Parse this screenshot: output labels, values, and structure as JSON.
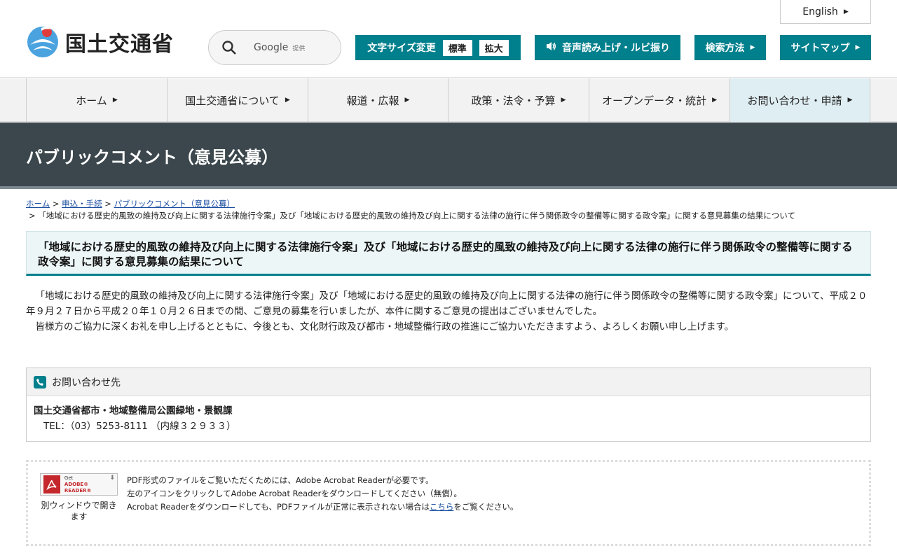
{
  "header": {
    "site_name": "国土交通省",
    "english": "English",
    "search": {
      "brand": "Google",
      "provided": "提供"
    },
    "font_size": {
      "label": "文字サイズ変更",
      "standard": "標準",
      "large": "拡大"
    },
    "voice": "音声読み上げ・ルビ振り",
    "search_method": "検索方法",
    "sitemap": "サイトマップ",
    "colors": {
      "accent": "#007f8c",
      "band": "#3b474d"
    }
  },
  "nav": {
    "items": [
      {
        "label": "ホーム"
      },
      {
        "label": "国土交通省について"
      },
      {
        "label": "報道・広報"
      },
      {
        "label": "政策・法令・予算"
      },
      {
        "label": "オープンデータ・統計"
      },
      {
        "label": "お問い合わせ・申請"
      }
    ]
  },
  "page_title": "パブリックコメント（意見公募）",
  "breadcrumb": {
    "home": "ホーム",
    "apply": "申込・手続",
    "public_comment": "パブリックコメント（意見公募）",
    "current": "「地域における歴史的風致の維持及び向上に関する法律施行令案」及び「地域における歴史的風致の維持及び向上に関する法律の施行に伴う関係政令の整備等に関する政令案」に関する意見募集の結果について"
  },
  "heading": "「地域における歴史的風致の維持及び向上に関する法律施行令案」及び「地域における歴史的風致の維持及び向上に関する法律の施行に伴う関係政令の整備等に関する政令案」に関する意見募集の結果について",
  "body": {
    "p1": "「地域における歴史的風致の維持及び向上に関する法律施行令案」及び「地域における歴史的風致の維持及び向上に関する法律の施行に伴う関係政令の整備等に関する政令案」について、平成２０年９月２７日から平成２０年１０月２６日までの間、ご意見の募集を行いましたが、本件に関するご意見の提出はございませんでした。",
    "p2": "皆様方のご協力に深くお礼を申し上げるとともに、今後とも、文化財行政及び都市・地域整備行政の推進にご協力いただきますよう、よろしくお願い申し上げます。"
  },
  "contact": {
    "title": "お問い合わせ先",
    "org": "国土交通省都市・地域整備局公園緑地・景観課",
    "tel": "TEL：（03）5253-8111 （内線３２９３３）"
  },
  "pdf": {
    "badge_get": "Get",
    "badge_adobe": "ADOBE® READER®",
    "caption": "別ウィンドウで開きます",
    "line1": "PDF形式のファイルをご覧いただくためには、Adobe Acrobat Readerが必要です。",
    "line2": "左のアイコンをクリックしてAdobe Acrobat Readerをダウンロードしてください（無償）。",
    "line3_pre": "Acrobat Readerをダウンロードしても、PDFファイルが正常に表示されない場合は",
    "line3_link": "こちら",
    "line3_post": "をご覧ください。"
  }
}
